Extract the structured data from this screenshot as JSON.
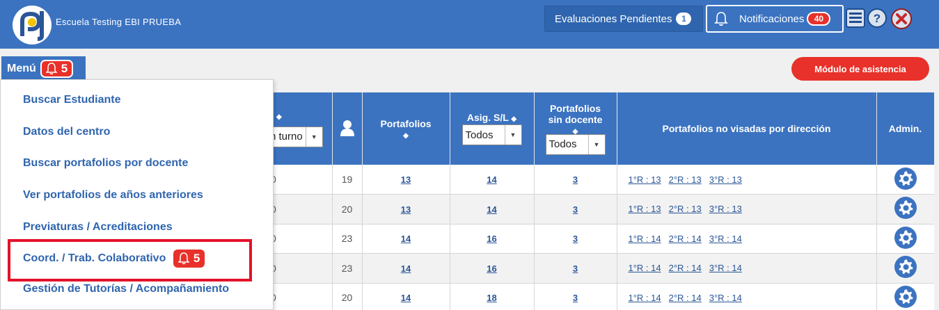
{
  "header": {
    "school_name": "Escuela Testing EBI PRUEBA",
    "evaluaciones_label": "Evaluaciones Pendientes",
    "evaluaciones_count": "1",
    "notificaciones_label": "Notificaciones",
    "notificaciones_count": "40"
  },
  "menu": {
    "label": "Menú",
    "badge": "5",
    "items": [
      {
        "label": "Buscar Estudiante"
      },
      {
        "label": "Datos del centro"
      },
      {
        "label": "Buscar portafolios por docente"
      },
      {
        "label": "Ver portafolios de años anteriores"
      },
      {
        "label": "Previaturas / Acreditaciones"
      },
      {
        "label": "Coord. / Trab. Colaborativo",
        "badge": "5"
      },
      {
        "label": "Gestión de Tutorías / Acompañamiento"
      }
    ]
  },
  "asistencia_label": "Módulo de asistencia",
  "table": {
    "headers": {
      "turno_select": "n turno",
      "portafolios": "Portafolios",
      "asig": "Asig. S/L",
      "asig_select": "Todos",
      "sin_docente_1": "Portafolios",
      "sin_docente_2": "sin docente",
      "sin_docente_select": "Todos",
      "no_visadas": "Portafolios no visadas por dirección",
      "admin": "Admin."
    },
    "rows": [
      {
        "c0": "0",
        "users": "19",
        "portafolios": "13",
        "asig": "14",
        "sin_docente": "3",
        "r1": "1°R : 13",
        "r2": "2°R : 13",
        "r3": "3°R : 13"
      },
      {
        "c0": "0",
        "users": "20",
        "portafolios": "13",
        "asig": "14",
        "sin_docente": "3",
        "r1": "1°R : 13",
        "r2": "2°R : 13",
        "r3": "3°R : 13"
      },
      {
        "c0": "0",
        "users": "23",
        "portafolios": "14",
        "asig": "16",
        "sin_docente": "3",
        "r1": "1°R : 14",
        "r2": "2°R : 14",
        "r3": "3°R : 14"
      },
      {
        "c0": "0",
        "users": "23",
        "portafolios": "14",
        "asig": "16",
        "sin_docente": "3",
        "r1": "1°R : 14",
        "r2": "2°R : 14",
        "r3": "3°R : 14"
      },
      {
        "c0": "0",
        "users": "20",
        "portafolios": "14",
        "asig": "18",
        "sin_docente": "3",
        "r1": "1°R : 14",
        "r2": "2°R : 14",
        "r3": "3°R : 14"
      }
    ]
  },
  "colors": {
    "primary": "#3b73c1",
    "alert": "#e8312a",
    "link": "#2a5596"
  },
  "icons": [
    "logo-icon",
    "bell-icon",
    "list-icon",
    "help-icon",
    "close-icon",
    "user-icon",
    "gear-icon",
    "sort-icon"
  ]
}
